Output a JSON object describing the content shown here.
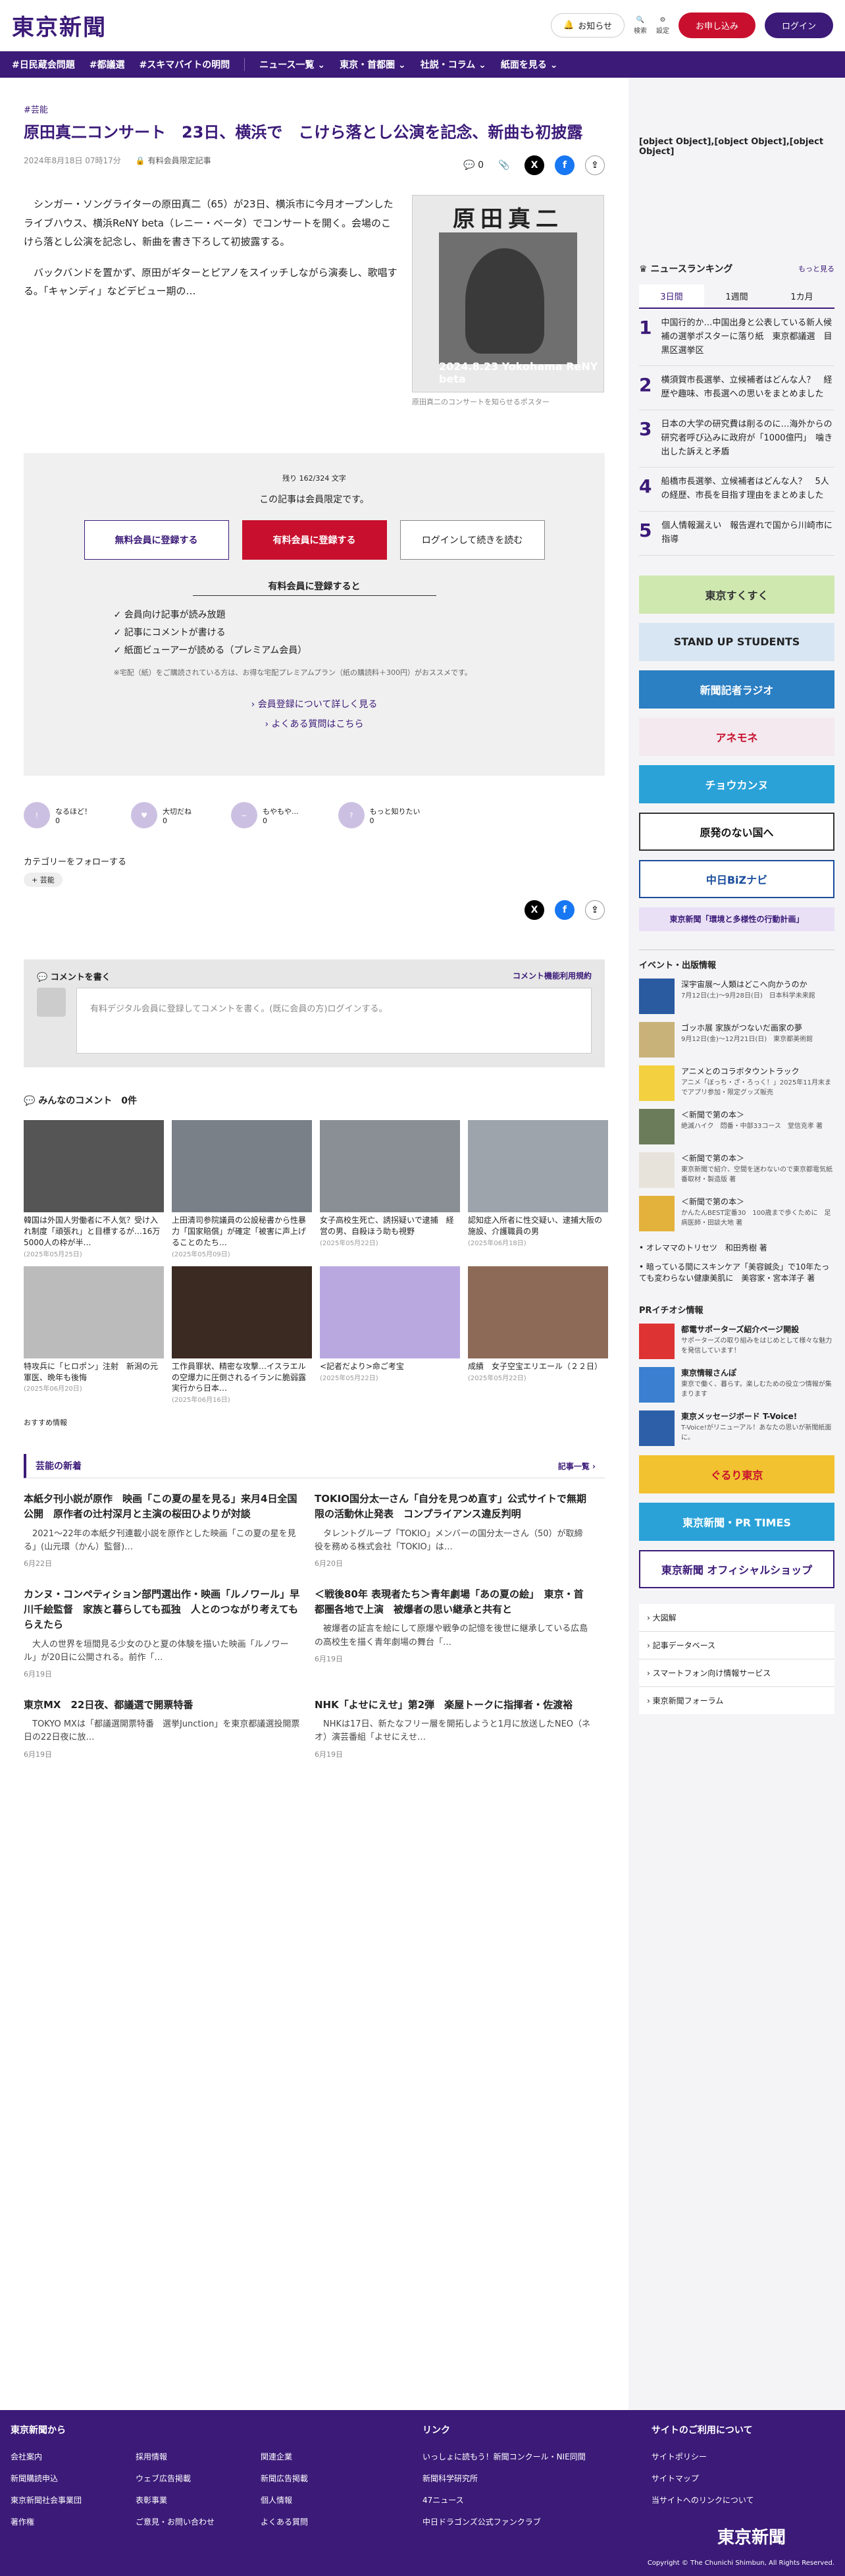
{
  "header": {
    "logo": "東京新聞",
    "notif": "お知らせ",
    "search": "検索",
    "settings": "設定",
    "apply": "お申し込み",
    "login": "ログイン"
  },
  "nav": [
    "#日民蔵会問題",
    "#都議選",
    "#スキマバイトの明問",
    "ニュース一覧 ⌄",
    "東京・首都圏 ⌄",
    "社説・コラム ⌄",
    "紙面を見る ⌄"
  ],
  "article": {
    "tag": "#芸能",
    "title": "原田真二コンサート　23日、横浜で　こけら落とし公演を記念、新曲も初披露",
    "date": "2024年8月18日 07時17分",
    "member": "有料会員限定記事",
    "comments": "0",
    "p1": "　シンガー・ソングライターの原田真二（65）が23日、横浜市に今月オープンしたライブハウス、横浜ReNY beta（レニー・ベータ）でコンサートを開く。会場のこけら落とし公演を記念し、新曲を書き下ろして初披露する。",
    "p2": "　バックバンドを置かず、原田がギターとピアノをスイッチしながら演奏し、歌唱する。「キャンディ」などデビュー期の…",
    "photo_title": "原田真二",
    "photo_date": "2024.8.23 Yokohama ReNY beta",
    "caption": "原田真二のコンサートを知らせるポスター"
  },
  "paywall": {
    "remain": "残り 162/324 文字",
    "limited": "この記事は会員限定です。",
    "free": "無料会員に登録する",
    "paid": "有料会員に登録する",
    "login": "ログインして続きを読む",
    "benefits_title": "有料会員に登録すると",
    "benefits": [
      "会員向け記事が読み放題",
      "記事にコメントが書ける",
      "紙面ビューアーが読める（プレミアム会員）"
    ],
    "note": "※宅配（紙）をご購読されている方は、お得な宅配プレミアムプラン（紙の購読料＋300円）がおススメです。",
    "more": "会員登録について詳しく見る",
    "faq": "よくある質問はこちら"
  },
  "reactions": [
    {
      "l": "なるほど！",
      "n": "0"
    },
    {
      "l": "大切だね",
      "n": "0"
    },
    {
      "l": "もやもや...",
      "n": "0"
    },
    {
      "l": "もっと知りたい",
      "n": "0"
    }
  ],
  "follow": {
    "title": "カテゴリーをフォローする",
    "tag": "芸能"
  },
  "comment": {
    "title": "コメントを書く",
    "rules": "コメント機能利用規約",
    "placeholder": "有料デジタル会員に登録してコメントを書く。(既に会員の方)ログインする。",
    "all": "みんなのコメント　0件"
  },
  "thumbs": [
    {
      "c": "韓国は外国人労働者に不人気？受け入れ制度「頑張れ」と目標するが…16万5000人の枠が半…",
      "d": "(2025年05月25日)",
      "bg": "#555"
    },
    {
      "c": "上田清司参院議員の公設秘書から性暴力「国家賠償」が確定「被害に声上げることのたち…",
      "d": "(2025年05月09日)",
      "bg": "#7a8088"
    },
    {
      "c": "女子高校生死亡、誘拐疑いで逮捕　経営の男、自殺ほう助も視野",
      "d": "(2025年05月22日)",
      "bg": "#8a8f96"
    },
    {
      "c": "認知症入所者に性交疑い、逮捕大阪の施設、介護職員の男",
      "d": "(2025年06月18日)",
      "bg": "#9ea4ab"
    },
    {
      "c": "特攻兵に「ヒロポン」注射　新潟の元軍医、晩年も後悔",
      "d": "(2025年06月20日)",
      "bg": "#bbb"
    },
    {
      "c": "工作員罪状、精密な攻撃…イスラエルの空爆力に圧倒されるイランに脆弱露　実行から日本…",
      "d": "(2025年06月16日)",
      "bg": "#3a2a22"
    },
    {
      "c": "<記者だより>命ご考宝",
      "d": "(2025年05月22日)",
      "bg": "#b9a8e0"
    },
    {
      "c": "成績　女子空宝エリエール（２２日）",
      "d": "(2025年05月22日)",
      "bg": "#8d6a58"
    }
  ],
  "recommend": "おすすめ情報",
  "section": {
    "title": "芸能の新着",
    "more": "記事一覧 ›"
  },
  "news": [
    {
      "h": "本紙夕刊小説が原作　映画「この夏の星を見る」来月4日全国公開　原作者の辻村深月と主演の桜田ひよりが対談",
      "p": "　2021〜22年の本紙夕刊連載小説を原作とした映画「この夏の星を見る」(山元環（かん）監督)…",
      "d": "6月22日"
    },
    {
      "h": "TOKIO国分太一さん「自分を見つめ直す」公式サイトで無期限の活動休止発表　コンプライアンス違反判明",
      "p": "　タレントグループ「TOKIO」メンバーの国分太一さん（50）が取締役を務める株式会社「TOKIO」は…",
      "d": "6月20日"
    },
    {
      "h": "カンヌ・コンペティション部門選出作・映画「ルノワール」早川千絵監督　家族と暮らしても孤独　人とのつながり考えてもらえたら",
      "p": "　大人の世界を垣間見る少女のひと夏の体験を描いた映画「ルノワール」が20日に公開される。前作「…",
      "d": "6月19日"
    },
    {
      "h": "＜戦後80年 表現者たち＞青年劇場「あの夏の絵」　東京・首都圏各地で上演　被爆者の思い継承と共有と",
      "p": "　被爆者の証言を絵にして原爆や戦争の記憶を後世に継承している広島の高校生を描く青年劇場の舞台「…",
      "d": "6月19日"
    },
    {
      "h": "東京MX　22日夜、都議選で開票特番",
      "p": "　TOKYO MXは「都議選開票特番　選挙Junction」を東京都議選投開票日の22日夜に放…",
      "d": "6月19日"
    },
    {
      "h": "NHK「よせにえせ」第2弾　楽屋トークに指揮者・佐渡裕",
      "p": "　NHKは17日、新たなフリー層を開拓しようと1月に放送したNEO（ネオ）演芸番組「よせにえせ…",
      "d": "6月19日"
    }
  ],
  "side": {
    "pr": [
      {
        "t": "都電サポーターズ紹介ページ開設",
        "s": "サポーターズの取り組みをはじめとして様々な魅力を発信しています！"
      },
      {
        "t": "東京情報さんぽ",
        "s": "東京で働く、暮らす。楽しむための役立つ情報が集まります"
      },
      {
        "t": "東京メッセージボード T-Voice!",
        "s": "T-Voice!がリニューアル！あなたの思いが新聞紙面に。"
      }
    ],
    "ranking": "ニュースランキング",
    "more": "もっと見る",
    "tabs": [
      "3日間",
      "1週間",
      "1カ月"
    ],
    "rank": [
      "中国行的か…中国出身と公表している新人候補の選挙ポスターに落り紙　東京都議選　目黒区選挙区",
      "横須賀市長選挙、立候補者はどんな人？　経歴や趣味、市長選への思いをまとめました",
      "日本の大学の研究費は削るのに…海外からの研究者呼び込みに政府が「1000億円」　噛き出した訴えと矛盾",
      "船橋市長選挙、立候補者はどんな人？　5人の経歴、市長を目指す理由をまとめました",
      "個人情報漏えい　報告遅れで国から川崎市に指導"
    ],
    "banners": [
      {
        "t": "東京すくすく",
        "bg": "#cfe8b0",
        "fg": "#333"
      },
      {
        "t": "STAND UP STUDENTS",
        "bg": "#d8e6f4",
        "fg": "#222"
      },
      {
        "t": "新聞記者ラジオ",
        "bg": "#2b7fc3",
        "fg": "#fff"
      },
      {
        "t": "アネモネ",
        "bg": "#f3e9ee",
        "fg": "#c8102e"
      },
      {
        "t": "チョウカンヌ",
        "bg": "#2aa2d8",
        "fg": "#fff"
      },
      {
        "t": "原発のない国へ",
        "bg": "#fff",
        "fg": "#111"
      },
      {
        "t": "中日BiZナビ",
        "bg": "#fff",
        "fg": "#1a4d9c"
      },
      {
        "t": "東京新聞「環境と多様性の行動計画」",
        "bg": "#e9e0f6",
        "fg": "#3b1a78"
      }
    ],
    "events_title": "イベント・出版情報",
    "events": [
      {
        "t": "深宇宙展〜人類はどこへ向かうのか",
        "s": "7月12日(土)〜9月28日(日)　日本科学未来館"
      },
      {
        "t": "ゴッホ展 家族がつないだ画家の夢",
        "s": "9月12日(金)〜12月21日(日)　東京都美術館"
      },
      {
        "t": "アニメとのコラボタウントラック",
        "s": "アニメ「ぼっち・ざ・ろっく！」2025年11月末までアプリ参加・限定グッズ販売"
      },
      {
        "t": "＜新聞で第の本＞",
        "s": "絶滅ハイク　悶番・中部33コース　堂信克孝 著"
      },
      {
        "t": "＜新聞で第の本＞",
        "s": "東京新聞で紹介、空間を迷わないので東京都電気紙番取材・製造版 著"
      },
      {
        "t": "＜新聞で第の本＞",
        "s": "かんたんBEST定番30　100歳まで歩くために　足病医師・田談大地 著"
      }
    ],
    "links": [
      "オレママのトリセツ　和田秀樹 著",
      "暗っている間にスキンケア「美容鍼灸」で10年たっても変わらない健康美肌に　美容家・宮本洋子 著"
    ],
    "pr_title": "PRイチオシ情報",
    "pr_banners": [
      "ぐるり東京",
      "東京新聞・PR TIMES",
      "東京新聞 オフィシャルショップ"
    ],
    "menu": [
      "大図解",
      "記事データベース",
      "スマートフォン向け情報サービス",
      "東京新聞フォーラム"
    ]
  },
  "footer": {
    "c1": "東京新聞から",
    "c2": "リンク",
    "c3": "サイトのご利用について",
    "col1a": [
      "会社案内",
      "新聞購読申込",
      "東京新聞社会事業団",
      "著作権"
    ],
    "col1b": [
      "採用情報",
      "ウェブ広告掲載",
      "表彰事業",
      "ご意見・お問い合わせ"
    ],
    "col1c": [
      "関連企業",
      "新聞広告掲載",
      "個人情報",
      "よくある質問"
    ],
    "col2": [
      "いっしょに読もう！新聞コンクール・NIE同間",
      "新聞科学研究所",
      "47ニュース",
      "中日ドラゴンズ公式ファンクラブ"
    ],
    "col3": [
      "サイトポリシー",
      "サイトマップ",
      "当サイトへのリンクについて"
    ],
    "logo": "東京新聞",
    "copy": "Copyright © The Chunichi Shimbun, All Rights Reserved."
  }
}
